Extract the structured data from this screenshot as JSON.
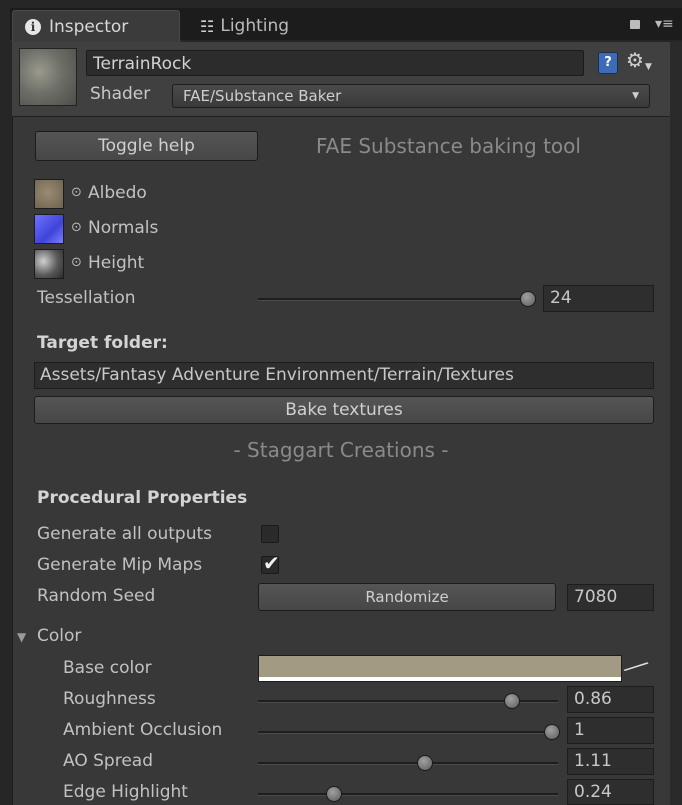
{
  "tabs": [
    {
      "label": "Inspector",
      "icon": "info-icon"
    },
    {
      "label": "Lighting",
      "icon": "sliders-icon"
    }
  ],
  "header": {
    "material_name": "TerrainRock",
    "shader_label": "Shader",
    "shader_value": "FAE/Substance Baker"
  },
  "toolbar": {
    "toggle_help": "Toggle help",
    "tool_title": "FAE Substance baking tool"
  },
  "textures": [
    {
      "label": "Albedo",
      "color": "#8a7a62"
    },
    {
      "label": "Normals",
      "color": "#5a5fe6"
    },
    {
      "label": "Height",
      "color": "#9a9a9a"
    }
  ],
  "tessellation": {
    "label": "Tessellation",
    "value": "24",
    "fraction": 0.98
  },
  "target_folder": {
    "label": "Target folder:",
    "path": "Assets/Fantasy Adventure Environment/Terrain/Textures",
    "bake_button": "Bake textures"
  },
  "credits": "- Staggart Creations -",
  "procedural": {
    "title": "Procedural Properties",
    "generate_all_outputs": {
      "label": "Generate all outputs",
      "checked": false
    },
    "generate_mip_maps": {
      "label": "Generate Mip Maps",
      "checked": true
    },
    "random_seed": {
      "label": "Random Seed",
      "button": "Randomize",
      "value": "7080"
    }
  },
  "color_section": {
    "title": "Color",
    "base_color": {
      "label": "Base color",
      "swatch": "#a39a84"
    },
    "sliders": [
      {
        "label": "Roughness",
        "value": "0.86",
        "fraction": 0.86
      },
      {
        "label": "Ambient Occlusion",
        "value": "1",
        "fraction": 1.0
      },
      {
        "label": "AO Spread",
        "value": "1.11",
        "fraction": 0.56
      },
      {
        "label": "Edge Highlight",
        "value": "0.24",
        "fraction": 0.24
      }
    ]
  }
}
